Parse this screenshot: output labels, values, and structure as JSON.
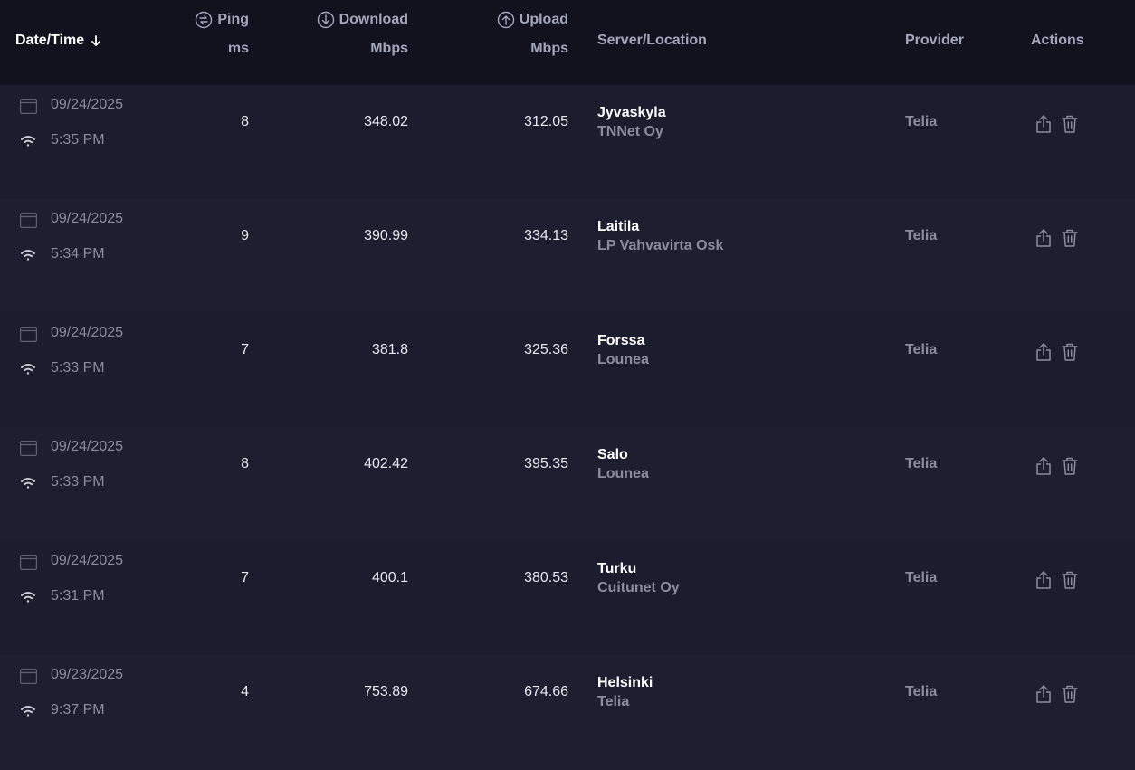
{
  "header": {
    "date_time": "Date/Time",
    "ping_label": "Ping",
    "ping_unit": "ms",
    "download_label": "Download",
    "download_unit": "Mbps",
    "upload_label": "Upload",
    "upload_unit": "Mbps",
    "server_location": "Server/Location",
    "provider": "Provider",
    "actions": "Actions"
  },
  "icons": {
    "sort": "arrow-down-icon",
    "ping": "ping-icon",
    "download": "download-icon",
    "upload": "upload-icon",
    "date": "calendar-icon",
    "connection": "wifi-icon",
    "share": "share-icon",
    "delete": "trash-icon"
  },
  "rows": [
    {
      "date": "09/24/2025",
      "time": "5:35 PM",
      "ping": "8",
      "download": "348.02",
      "upload": "312.05",
      "city": "Jyvaskyla",
      "isp": "TNNet Oy",
      "provider": "Telia"
    },
    {
      "date": "09/24/2025",
      "time": "5:34 PM",
      "ping": "9",
      "download": "390.99",
      "upload": "334.13",
      "city": "Laitila",
      "isp": "LP Vahvavirta Osk",
      "provider": "Telia"
    },
    {
      "date": "09/24/2025",
      "time": "5:33 PM",
      "ping": "7",
      "download": "381.8",
      "upload": "325.36",
      "city": "Forssa",
      "isp": "Lounea",
      "provider": "Telia"
    },
    {
      "date": "09/24/2025",
      "time": "5:33 PM",
      "ping": "8",
      "download": "402.42",
      "upload": "395.35",
      "city": "Salo",
      "isp": "Lounea",
      "provider": "Telia"
    },
    {
      "date": "09/24/2025",
      "time": "5:31 PM",
      "ping": "7",
      "download": "400.1",
      "upload": "380.53",
      "city": "Turku",
      "isp": "Cuitunet Oy",
      "provider": "Telia"
    },
    {
      "date": "09/23/2025",
      "time": "9:37 PM",
      "ping": "4",
      "download": "753.89",
      "upload": "674.66",
      "city": "Helsinki",
      "isp": "Telia",
      "provider": "Telia"
    }
  ]
}
